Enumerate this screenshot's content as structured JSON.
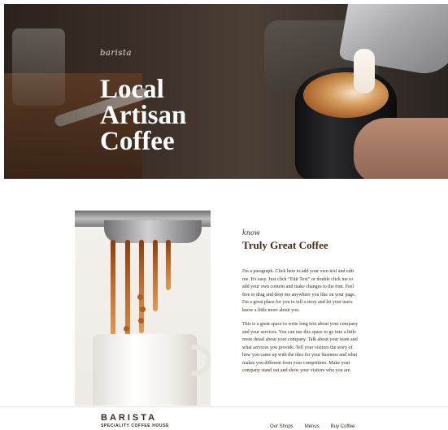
{
  "hero": {
    "brand": "barista",
    "title_lines": [
      "Local",
      "Artisan",
      "Coffee"
    ]
  },
  "about": {
    "kicker": "know",
    "heading": "Truly Great Coffee",
    "paragraphs": [
      "I'm a paragraph. Click here to add your own text and edit me. It's easy. Just click “Edit Text” or double click me to add your own content and make changes to the font. Feel free to drag and drop me anywhere you like on your page. I'm a great place for you to tell a story and let your users know a little more about you.",
      "This is a great space to write long text about your company and your services. You can use this space to go into a little more detail about your company. Talk about your team and what services you provide. Tell your visitors the story of how you came up with the idea for your business and what makes you different from your competitors. Make your company stand out and show your visitors who you are."
    ]
  },
  "footer": {
    "logo": "BARISTA",
    "tagline": "SPECIALITY COFFEE HOUSE",
    "nav": [
      {
        "label": "Our Shops"
      },
      {
        "label": "Menus"
      },
      {
        "label": "Buy Coffee"
      }
    ]
  }
}
